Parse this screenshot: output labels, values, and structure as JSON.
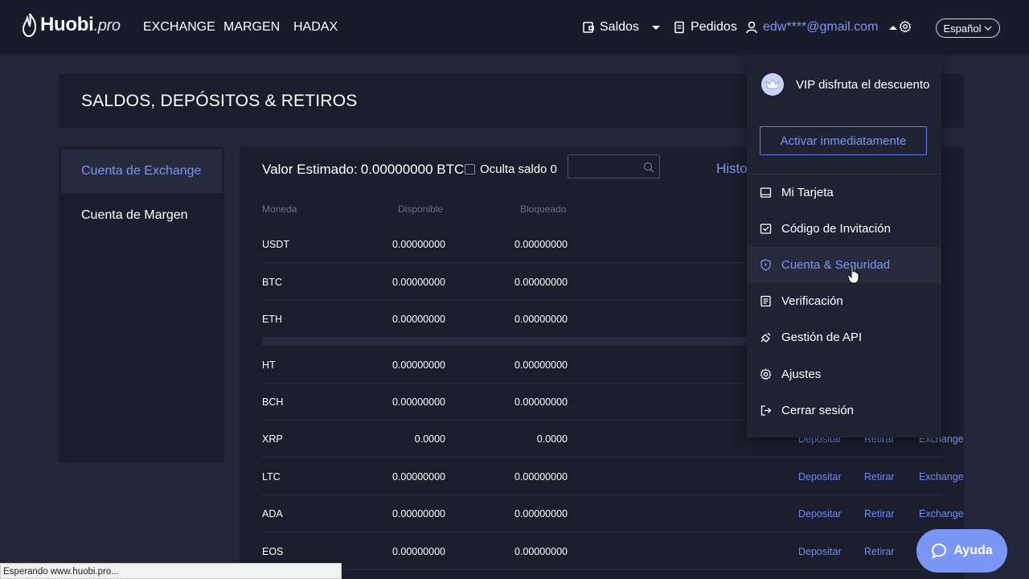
{
  "brand": {
    "name": "Huobi",
    "suffix": ".pro"
  },
  "nav": {
    "links": [
      "EXCHANGE",
      "MARGEN",
      "HADAX"
    ],
    "saldos": "Saldos",
    "pedidos": "Pedidos",
    "user_email": "edw****@gmail.com",
    "language": "Español"
  },
  "page_title": "SALDOS, DEPÓSITOS & RETIROS",
  "sidebar": {
    "items": [
      {
        "label": "Cuenta de Exchange",
        "active": true
      },
      {
        "label": "Cuenta de Margen",
        "active": false
      }
    ]
  },
  "main": {
    "valor_label": "Valor Estimado:",
    "valor_value": "0.00000000 BTC",
    "oculta_label": "Oculta saldo 0",
    "search_placeholder": "",
    "historial_label": "Histo",
    "columns": [
      "Moneda",
      "Disponible",
      "Bloqueado"
    ],
    "rows": [
      {
        "coin": "USDT",
        "disponible": "0.00000000",
        "bloqueado": "0.00000000"
      },
      {
        "coin": "BTC",
        "disponible": "0.00000000",
        "bloqueado": "0.00000000"
      },
      {
        "coin": "ETH",
        "disponible": "0.00000000",
        "bloqueado": "0.00000000"
      },
      {
        "coin": "HT",
        "disponible": "0.00000000",
        "bloqueado": "0.00000000"
      },
      {
        "coin": "BCH",
        "disponible": "0.00000000",
        "bloqueado": "0.00000000"
      },
      {
        "coin": "XRP",
        "disponible": "0.0000",
        "bloqueado": "0.0000"
      },
      {
        "coin": "LTC",
        "disponible": "0.00000000",
        "bloqueado": "0.00000000"
      },
      {
        "coin": "ADA",
        "disponible": "0.00000000",
        "bloqueado": "0.00000000"
      },
      {
        "coin": "EOS",
        "disponible": "0.00000000",
        "bloqueado": "0.00000000"
      }
    ],
    "actions": {
      "depositar": "Depositar",
      "retirar": "Retirar",
      "exchange": "Exchange",
      "exchange_cut": "Exch"
    }
  },
  "dropdown": {
    "vip_text": "VIP disfruta el descuento",
    "activar": "Activar inmediatamente",
    "items": [
      {
        "label": "Mi Tarjeta",
        "icon": "card-icon"
      },
      {
        "label": "Código de Invitación",
        "icon": "invite-icon"
      },
      {
        "label": "Cuenta & Seguridad",
        "icon": "shield-icon"
      },
      {
        "label": "Verificación",
        "icon": "document-icon"
      },
      {
        "label": "Gestión de API",
        "icon": "api-icon"
      },
      {
        "label": "Ajustes",
        "icon": "gear-icon"
      },
      {
        "label": "Cerrar sesión",
        "icon": "logout-icon"
      }
    ]
  },
  "status_bar": "Esperando www.huobi.pro...",
  "help_button": "Ayuda",
  "colors": {
    "accent": "#7b95f5",
    "background": "#232638",
    "panel": "#1b1d2c"
  }
}
